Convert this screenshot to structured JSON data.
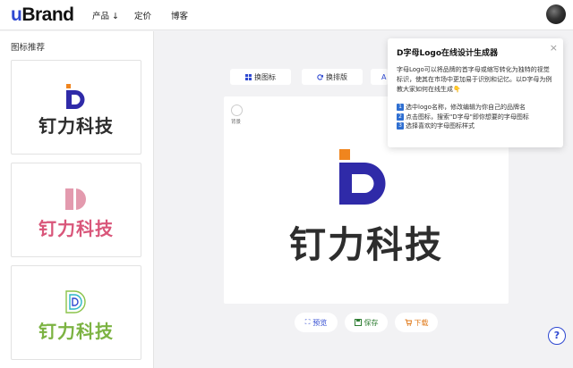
{
  "brand": {
    "u": "u",
    "rest": "Brand"
  },
  "nav": {
    "products": "产品",
    "products_caret": "↓",
    "pricing": "定价",
    "blog": "博客"
  },
  "sidebar": {
    "title": "图标推荐",
    "cards": [
      {
        "word": "钉力科技",
        "color": "#2d2d2d"
      },
      {
        "word": "钉力科技",
        "color": "#d9567a"
      },
      {
        "word": "钉力科技",
        "color": "#7cb342"
      }
    ]
  },
  "toolbar": {
    "change_icon": "换图标",
    "change_layout": "换排版",
    "third_initial": "A"
  },
  "canvas": {
    "bg_label": "背景",
    "word": "钉力科技"
  },
  "actions": {
    "preview": "预览",
    "save": "保存",
    "download": "下载"
  },
  "tooltip": {
    "title": "D字母Logo在线设计生成器",
    "body": "字母Logo可以将品牌的首字母或缩写转化为独特的视觉标识，使其在市场中更加易于识别和记忆。以D字母为例教大家如何在线生成👇",
    "steps": [
      {
        "num": "1",
        "text": "选中logo名称，修改编辑为你自己的品牌名"
      },
      {
        "num": "2",
        "text": "点击图标，搜索\"D字母\"即你想要的字母图标"
      },
      {
        "num": "3",
        "text": "选择喜欢的字母图标样式"
      }
    ],
    "close": "×"
  },
  "help": "?",
  "colors": {
    "primary": "#2f49d1",
    "orange": "#f0851e",
    "pink": "#d9567a",
    "green": "#7cb342"
  }
}
